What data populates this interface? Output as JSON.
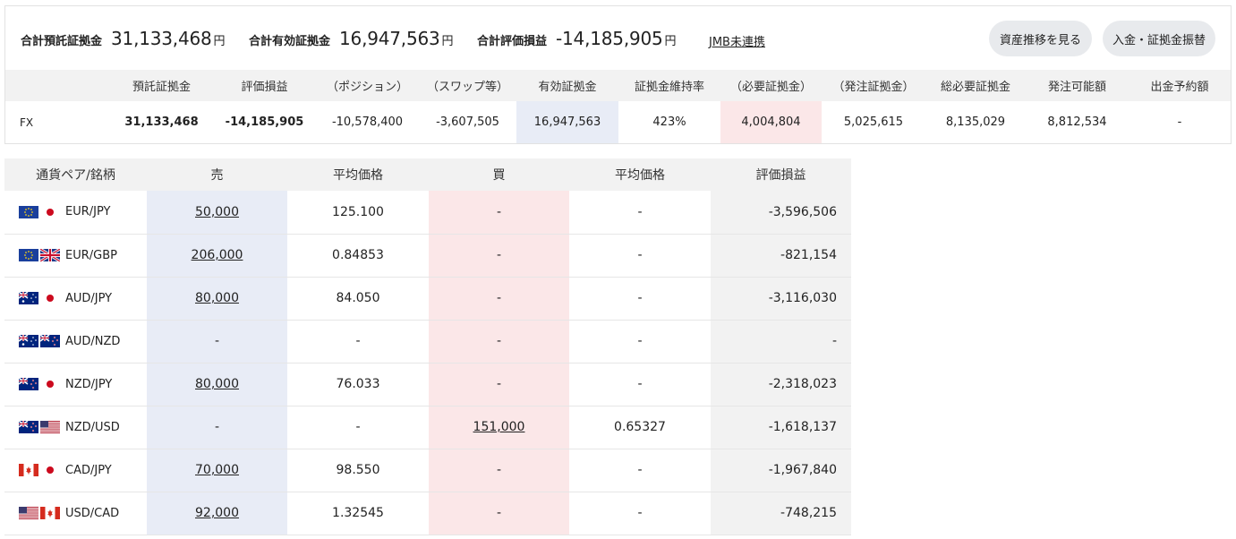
{
  "summary": {
    "total_deposit_label": "合計預託証拠金",
    "total_deposit_value": "31,133,468",
    "total_effective_label": "合計有効証拠金",
    "total_effective_value": "16,947,563",
    "total_pl_label": "合計評価損益",
    "total_pl_value": "-14,185,905",
    "unit": "円",
    "jmb_link": "JMB未連携",
    "asset_button": "資産推移を見る",
    "deposit_button": "入金・証拠金振替"
  },
  "summary_table": {
    "headers": [
      "",
      "預託証拠金",
      "評価損益",
      "（ポジション）",
      "（スワップ等）",
      "有効証拠金",
      "証拠金維持率",
      "（必要証拠金）",
      "（発注証拠金）",
      "総必要証拠金",
      "発注可能額",
      "出金予約額"
    ],
    "row": {
      "label": "FX",
      "deposit": "31,133,468",
      "pl": "-14,185,905",
      "position": "-10,578,400",
      "swap": "-3,607,505",
      "effective": "16,947,563",
      "maintenance_rate": "423%",
      "required": "4,004,804",
      "order_margin": "5,025,615",
      "total_required": "8,135,029",
      "orderable": "8,812,534",
      "withdrawal": "-"
    }
  },
  "positions": {
    "headers": {
      "pair": "通貨ペア/銘柄",
      "sell": "売",
      "sell_avg": "平均価格",
      "buy": "買",
      "buy_avg": "平均価格",
      "pl": "評価損益"
    },
    "rows": [
      {
        "pair": "EUR/JPY",
        "sell": "50,000",
        "sell_avg": "125.100",
        "buy": "-",
        "buy_avg": "-",
        "pl": "-3,596,506"
      },
      {
        "pair": "EUR/GBP",
        "sell": "206,000",
        "sell_avg": "0.84853",
        "buy": "-",
        "buy_avg": "-",
        "pl": "-821,154"
      },
      {
        "pair": "AUD/JPY",
        "sell": "80,000",
        "sell_avg": "84.050",
        "buy": "-",
        "buy_avg": "-",
        "pl": "-3,116,030"
      },
      {
        "pair": "AUD/NZD",
        "sell": "-",
        "sell_avg": "-",
        "buy": "-",
        "buy_avg": "-",
        "pl": "-"
      },
      {
        "pair": "NZD/JPY",
        "sell": "80,000",
        "sell_avg": "76.033",
        "buy": "-",
        "buy_avg": "-",
        "pl": "-2,318,023"
      },
      {
        "pair": "NZD/USD",
        "sell": "-",
        "sell_avg": "-",
        "buy": "151,000",
        "buy_avg": "0.65327",
        "pl": "-1,618,137"
      },
      {
        "pair": "CAD/JPY",
        "sell": "70,000",
        "sell_avg": "98.550",
        "buy": "-",
        "buy_avg": "-",
        "pl": "-1,967,840"
      },
      {
        "pair": "USD/CAD",
        "sell": "92,000",
        "sell_avg": "1.32545",
        "buy": "-",
        "buy_avg": "-",
        "pl": "-748,215"
      }
    ]
  },
  "colors": {
    "sell_bg": "#e8ecf6",
    "buy_bg": "#fbe7e8",
    "header_bg": "#f2f2f2",
    "button_bg": "#e8eaed"
  }
}
